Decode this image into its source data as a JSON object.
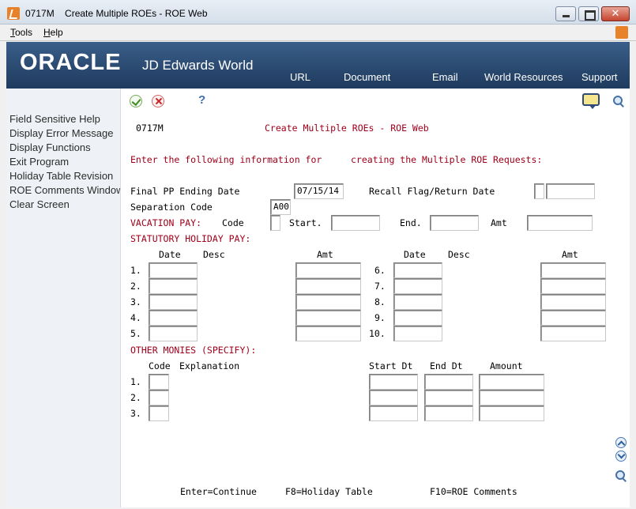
{
  "window": {
    "title": "0717M    Create Multiple ROEs - ROE Web"
  },
  "menu": {
    "tools": "Tools",
    "help": "Help"
  },
  "banner": {
    "logo": "ORACLE",
    "product": "JD Edwards World",
    "nav": [
      "URL",
      "Document",
      "Email",
      "World Resources",
      "Support"
    ]
  },
  "sidebar": {
    "items": [
      "Field Sensitive Help",
      "Display Error Message",
      "Display Functions",
      "Exit Program",
      "Holiday Table Revision",
      "ROE Comments Window",
      "Clear Screen"
    ]
  },
  "toolbar": {
    "help": "?"
  },
  "form": {
    "program_id": "0717M",
    "screen_title": "Create Multiple ROEs - ROE Web",
    "instruction_a": "Enter the following information for",
    "instruction_b": "creating the Multiple ROE Requests:",
    "final_pp_label": "Final PP Ending Date",
    "final_pp_value": "07/15/14",
    "recall_label": "Recall Flag/Return Date",
    "separation_label": "Separation Code",
    "separation_value": "A00",
    "vacation_label": "VACATION PAY:",
    "code_label": "Code",
    "start_label": "Start.",
    "end_label": "End.",
    "amt_label": "Amt",
    "stat_label": "STATUTORY HOLIDAY PAY:",
    "col_date": "Date",
    "col_desc": "Desc",
    "col_amt": "Amt",
    "left_rows": [
      "1.",
      "2.",
      "3.",
      "4.",
      "5."
    ],
    "right_rows": [
      "6.",
      "7.",
      "8.",
      "9.",
      "10."
    ],
    "other_label": "OTHER MONIES (SPECIFY):",
    "other_code": "Code",
    "other_expl": "Explanation",
    "other_start": "Start Dt",
    "other_end": "End Dt",
    "other_amount": "Amount",
    "other_rows": [
      "1.",
      "2.",
      "3."
    ]
  },
  "function_keys": {
    "enter": "Enter=Continue",
    "f8": "F8=Holiday Table",
    "f10": "F10=ROE Comments"
  },
  "colors": {
    "red_text": "#a0001a",
    "banner": "#2c4c73"
  }
}
